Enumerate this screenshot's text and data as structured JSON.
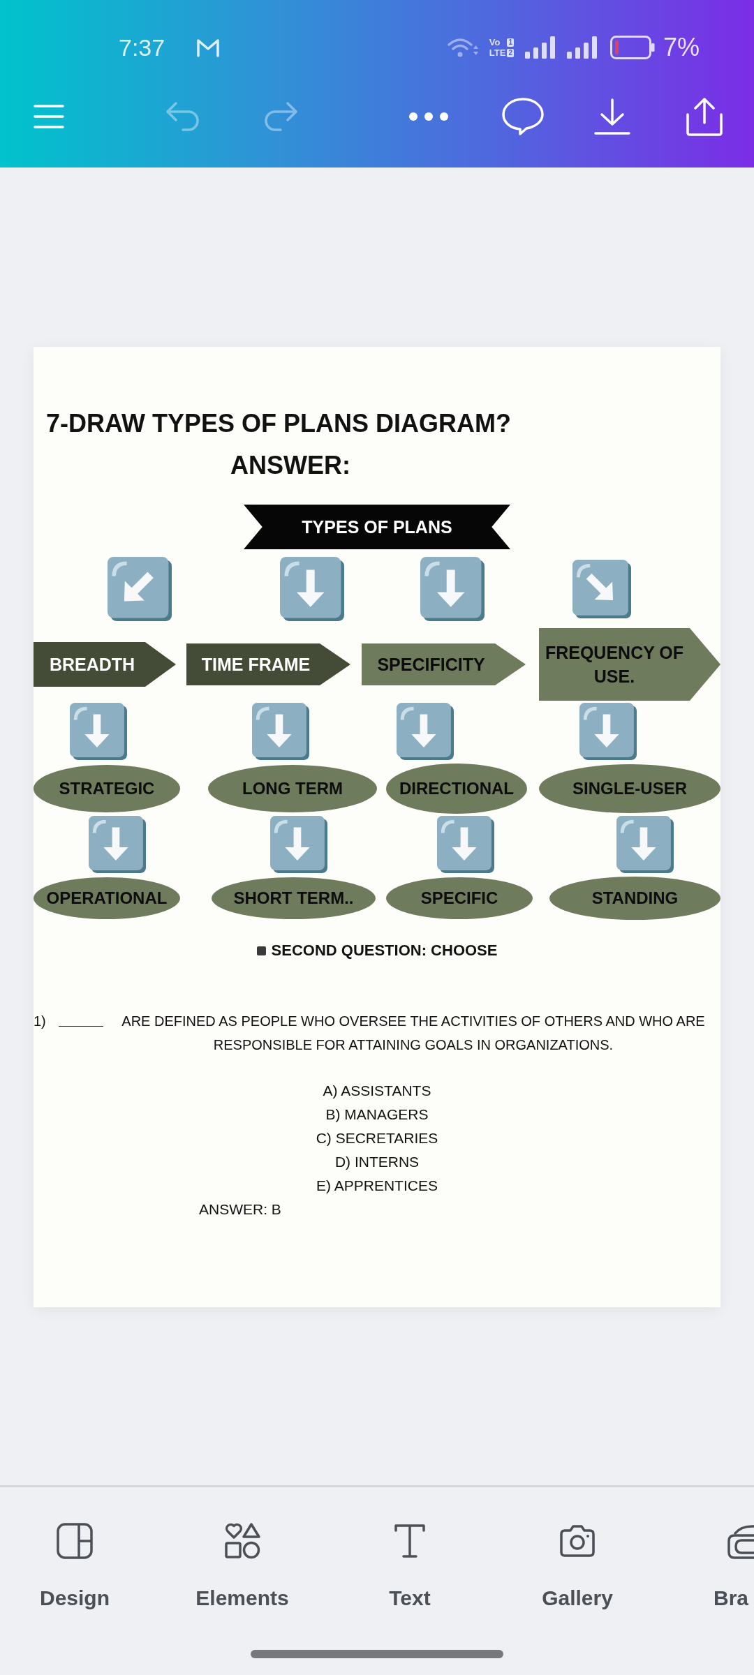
{
  "status_bar": {
    "time": "7:37",
    "network": {
      "top": "Vo",
      "bottom": "LTE",
      "sims": [
        "1",
        "2"
      ]
    },
    "battery": "7%"
  },
  "toolbar": [
    {
      "kind": "menu",
      "disabled": false
    },
    {
      "kind": "undo",
      "disabled": true
    },
    {
      "kind": "redo",
      "disabled": true
    },
    {
      "kind": "more",
      "disabled": false
    },
    {
      "kind": "comment",
      "disabled": false
    },
    {
      "kind": "download",
      "disabled": false
    },
    {
      "kind": "share",
      "disabled": false
    }
  ],
  "page": {
    "title": "7-DRAW TYPES OF PLANS DIAGRAM?",
    "answer_heading": "ANSWER:",
    "diagram": {
      "banner": "TYPES OF PLANS",
      "branches": [
        {
          "kind": "down-left",
          "label": "BREADTH",
          "color": "#444c37",
          "items": [
            "STRATEGIC",
            "OPERATIONAL"
          ]
        },
        {
          "kind": "down",
          "label": "TIME FRAME",
          "color": "#444c37",
          "items": [
            "LONG TERM",
            "SHORT TERM.."
          ]
        },
        {
          "kind": "down",
          "label": "SPECIFICITY",
          "color": "#6f7b5d",
          "items": [
            "DIRECTIONAL",
            "SPECIFIC"
          ]
        },
        {
          "kind": "down-right",
          "label": "FREQUENCY OF USE.",
          "color": "#6f7b5d",
          "items": [
            "SINGLE-USER",
            "STANDING"
          ]
        }
      ]
    },
    "section_heading": "SECOND QUESTION: CHOOSE",
    "question": {
      "number": "1)",
      "text": "ARE DEFINED AS PEOPLE WHO OVERSEE THE ACTIVITIES OF OTHERS AND WHO ARE RESPONSIBLE FOR ATTAINING GOALS IN ORGANIZATIONS.",
      "options": [
        "A) ASSISTANTS",
        "B) MANAGERS",
        "C) SECRETARIES",
        "D) INTERNS",
        "E) APPRENTICES"
      ],
      "answer": "ANSWER: B"
    }
  },
  "bottom_nav": [
    {
      "kind": "design",
      "label": "Design"
    },
    {
      "kind": "elements",
      "label": "Elements"
    },
    {
      "kind": "text",
      "label": "Text"
    },
    {
      "kind": "gallery",
      "label": "Gallery"
    },
    {
      "kind": "brand",
      "label": "Bra"
    }
  ]
}
